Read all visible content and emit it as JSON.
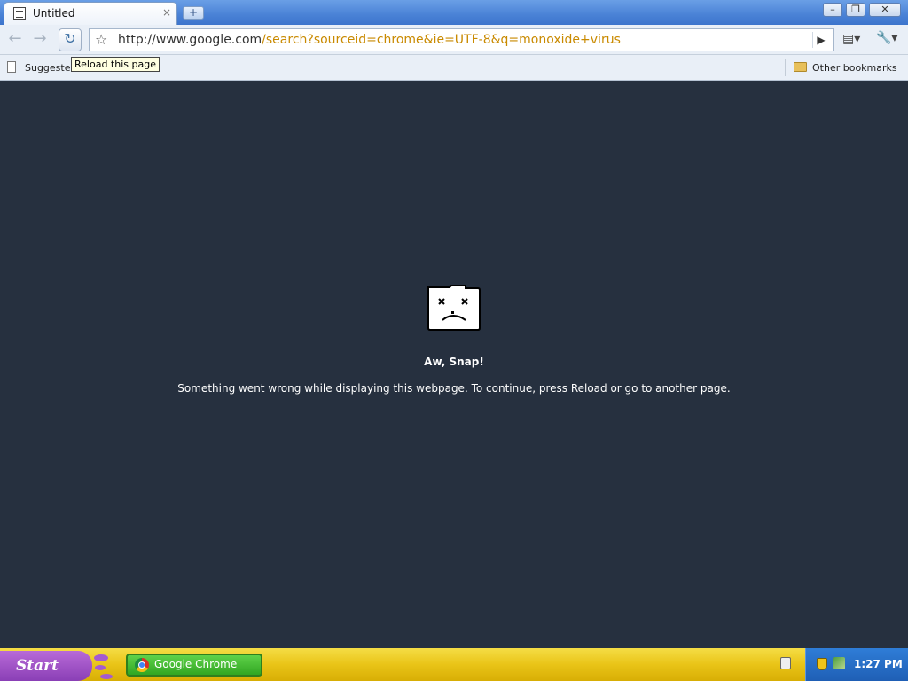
{
  "browser": {
    "tab": {
      "title": "Untitled",
      "close": "×"
    },
    "new_tab": "+",
    "window_controls": {
      "minimize": "–",
      "restore": "❐",
      "close": "✕"
    },
    "nav": {
      "back": "←",
      "forward": "→",
      "reload": "↻",
      "star": "☆"
    },
    "omnibox": {
      "url_host": "http://www.google.com",
      "url_path": "/search?sourceid=chrome&ie=UTF-8&q=monoxide+virus",
      "go": "▶"
    },
    "menus": {
      "page": "▤▾",
      "wrench": "🔧▾"
    },
    "bookmarks": {
      "suggested": "Suggeste",
      "other": "Other bookmarks"
    },
    "tooltip": "Reload this page"
  },
  "content": {
    "title": "Aw, Snap!",
    "message": "Something went wrong while displaying this webpage. To continue, press Reload or go to another page."
  },
  "taskbar": {
    "start": "Start",
    "task_label": "Google Chrome",
    "clock": "1:27 PM"
  },
  "icons": [
    "sad-tab-icon",
    "chrome-icon",
    "folder-icon",
    "page-icon",
    "shield-icon",
    "network-icon",
    "star-icon",
    "reload-icon",
    "wrench-icon"
  ]
}
